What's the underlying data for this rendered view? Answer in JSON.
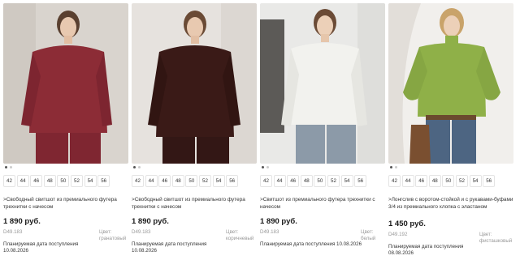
{
  "products": [
    {
      "title": ">Свободный свитшот из премиального футера трехнитки с начесом",
      "price": "1 890 руб.",
      "article": "D49.183",
      "color": "Цвет: гранатовый",
      "plan_label": "Планируемая дата поступления",
      "plan_date": "10.08.2026",
      "garment_color": "#8c2c36",
      "sizes": [
        "42",
        "44",
        "46",
        "48",
        "50",
        "52",
        "54",
        "56"
      ]
    },
    {
      "title": ">Свободный свитшот из премиального футера трехнитки с начесом",
      "price": "1 890 руб.",
      "article": "D49.183",
      "color": "Цвет: коричневый",
      "plan_label": "Планируемая дата поступления",
      "plan_date": "10.08.2026",
      "garment_color": "#3a1a17",
      "sizes": [
        "42",
        "44",
        "46",
        "48",
        "50",
        "52",
        "54",
        "56"
      ]
    },
    {
      "title": ">Свитшот из премиального футера трехнитки с начесом",
      "price": "1 890 руб.",
      "article": "D49.183",
      "color": "Цвет: белый",
      "plan_label": "Планируемая дата поступления 10.08.2026",
      "plan_date": "",
      "garment_color": "#f2f2ee",
      "sizes": [
        "42",
        "44",
        "46",
        "48",
        "50",
        "52",
        "54",
        "56"
      ]
    },
    {
      "title": ">Лонгслив с воротом-стойкой и с рукавами-буфами 3/4 из премиального хлопка с эластаном",
      "price": "1 450 руб.",
      "article": "D49.192",
      "color": "Цвет: фисташковый",
      "plan_label": "Планируемая дата поступления",
      "plan_date": "08.08.2026",
      "garment_color": "#8fb048",
      "sizes": [
        "42",
        "44",
        "46",
        "48",
        "50",
        "52",
        "54",
        "56"
      ]
    }
  ]
}
